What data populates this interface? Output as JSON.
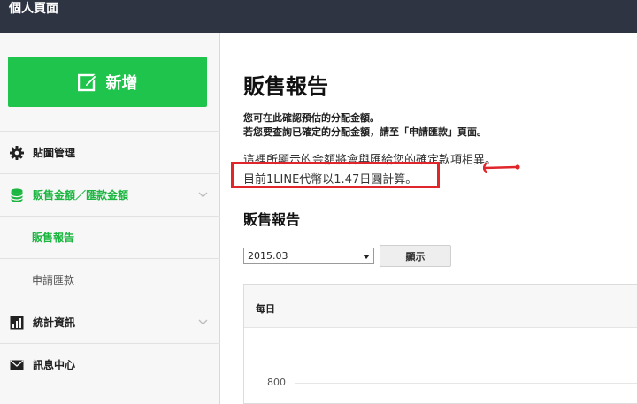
{
  "header": {
    "title": "個人頁面"
  },
  "sidebar": {
    "new_button": "新增",
    "items": [
      {
        "label": "貼圖管理",
        "icon": "gear-icon"
      },
      {
        "label": "販售金額／匯款金額",
        "icon": "database-icon",
        "active": true
      },
      {
        "label": "販售報告",
        "sub": true,
        "active": true
      },
      {
        "label": "申請匯款",
        "sub": true
      },
      {
        "label": "統計資訊",
        "icon": "bar-chart-icon"
      },
      {
        "label": "訊息中心",
        "icon": "envelope-icon"
      }
    ]
  },
  "main": {
    "title": "販售報告",
    "desc_line1": "您可在此確認預估的分配金額。",
    "desc_line2": "若您要查詢已確定的分配金額，請至「申請匯款」頁面。",
    "note_line1": "這裡所顯示的金額將會與匯給您的確定款項相異。",
    "note_line2": "目前1LINE代幣以1.47日圓計算。",
    "section_title": "販售報告",
    "month_select": "2015.03",
    "show_button": "顯示",
    "chart_header": "每日",
    "y_tick": "800"
  },
  "colors": {
    "accent": "#1ec44b",
    "topbar": "#2f3443",
    "annotation": "#e0252b"
  }
}
